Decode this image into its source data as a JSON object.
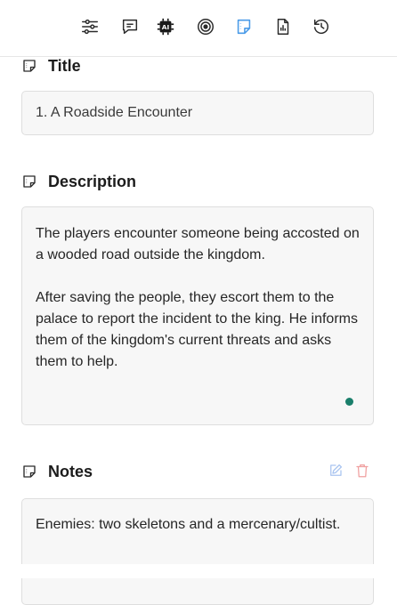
{
  "toolbar": {
    "icons": [
      "settings-sliders-icon",
      "comment-icon",
      "ai-chip-icon",
      "target-icon",
      "note-icon",
      "report-icon",
      "history-icon"
    ],
    "active_icon": "note-icon",
    "active_color": "#4a9be8"
  },
  "title_section": {
    "label": "Title",
    "value": "1. A Roadside Encounter"
  },
  "description_section": {
    "label": "Description",
    "paragraph_1": "The players encounter someone being accosted on a wooded road outside the kingdom.",
    "paragraph_2": "After saving the people, they escort them to the palace to report the incident to the king. He informs them of the kingdom's current threats and asks them to help.",
    "status_color": "#1a7f6b"
  },
  "notes_section": {
    "label": "Notes",
    "value": "Enemies: two skeletons and a mercenary/cultist.",
    "edit_color": "#a9c4f0",
    "delete_color": "#f0a0a0"
  }
}
